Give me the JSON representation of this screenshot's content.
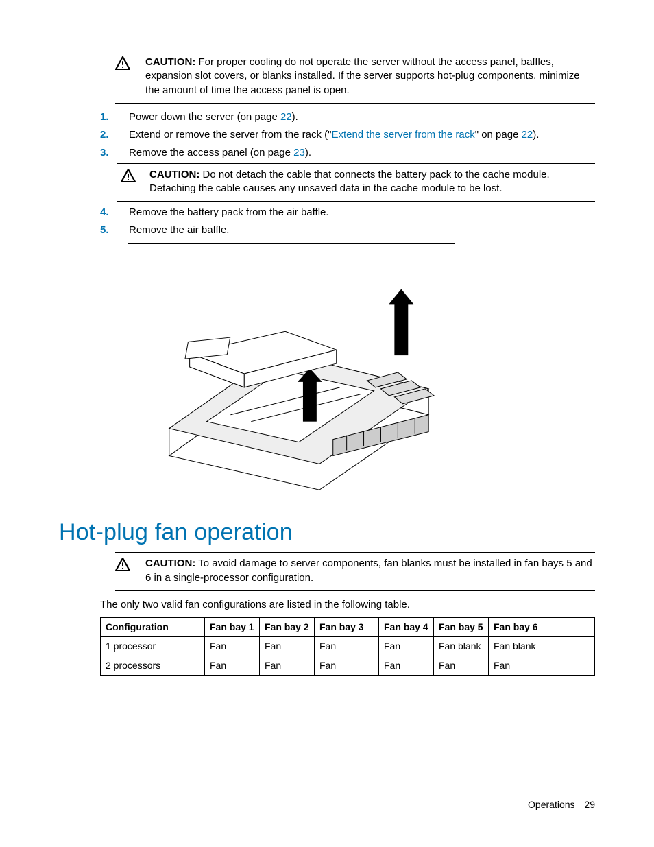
{
  "caution1": {
    "label": "CAUTION:",
    "text": "For proper cooling do not operate the server without the access panel, baffles, expansion slot covers, or blanks installed. If the server supports hot-plug components, minimize the amount of time the access panel is open."
  },
  "steps": {
    "s1a": "Power down the server (on page ",
    "s1link": "22",
    "s1b": ").",
    "s2a": "Extend or remove the server from the rack (\"",
    "s2link": "Extend the server from the rack",
    "s2b": "\" on page ",
    "s2pg": "22",
    "s2c": ").",
    "s3a": "Remove the access panel (on page ",
    "s3link": "23",
    "s3b": ").",
    "caution2": {
      "label": "CAUTION:",
      "text": "Do not detach the cable that connects the battery pack to the cache module. Detaching the cable causes any unsaved data in the cache module to be lost."
    },
    "s4": "Remove the battery pack from the air baffle.",
    "s5": "Remove the air baffle."
  },
  "section_title": "Hot-plug fan operation",
  "caution3": {
    "label": "CAUTION:",
    "text": "To avoid damage to server components, fan blanks must be installed in fan bays 5 and 6 in a single-processor configuration."
  },
  "intro": "The only two valid fan configurations are listed in the following table.",
  "table": {
    "headers": [
      "Configuration",
      "Fan bay 1",
      "Fan bay 2",
      "Fan bay 3",
      "Fan bay 4",
      "Fan bay 5",
      "Fan bay 6"
    ],
    "rows": [
      [
        "1 processor",
        "Fan",
        "Fan",
        "Fan",
        "Fan",
        "Fan blank",
        "Fan blank"
      ],
      [
        "2 processors",
        "Fan",
        "Fan",
        "Fan",
        "Fan",
        "Fan",
        "Fan"
      ]
    ]
  },
  "footer": {
    "section": "Operations",
    "page": "29"
  }
}
